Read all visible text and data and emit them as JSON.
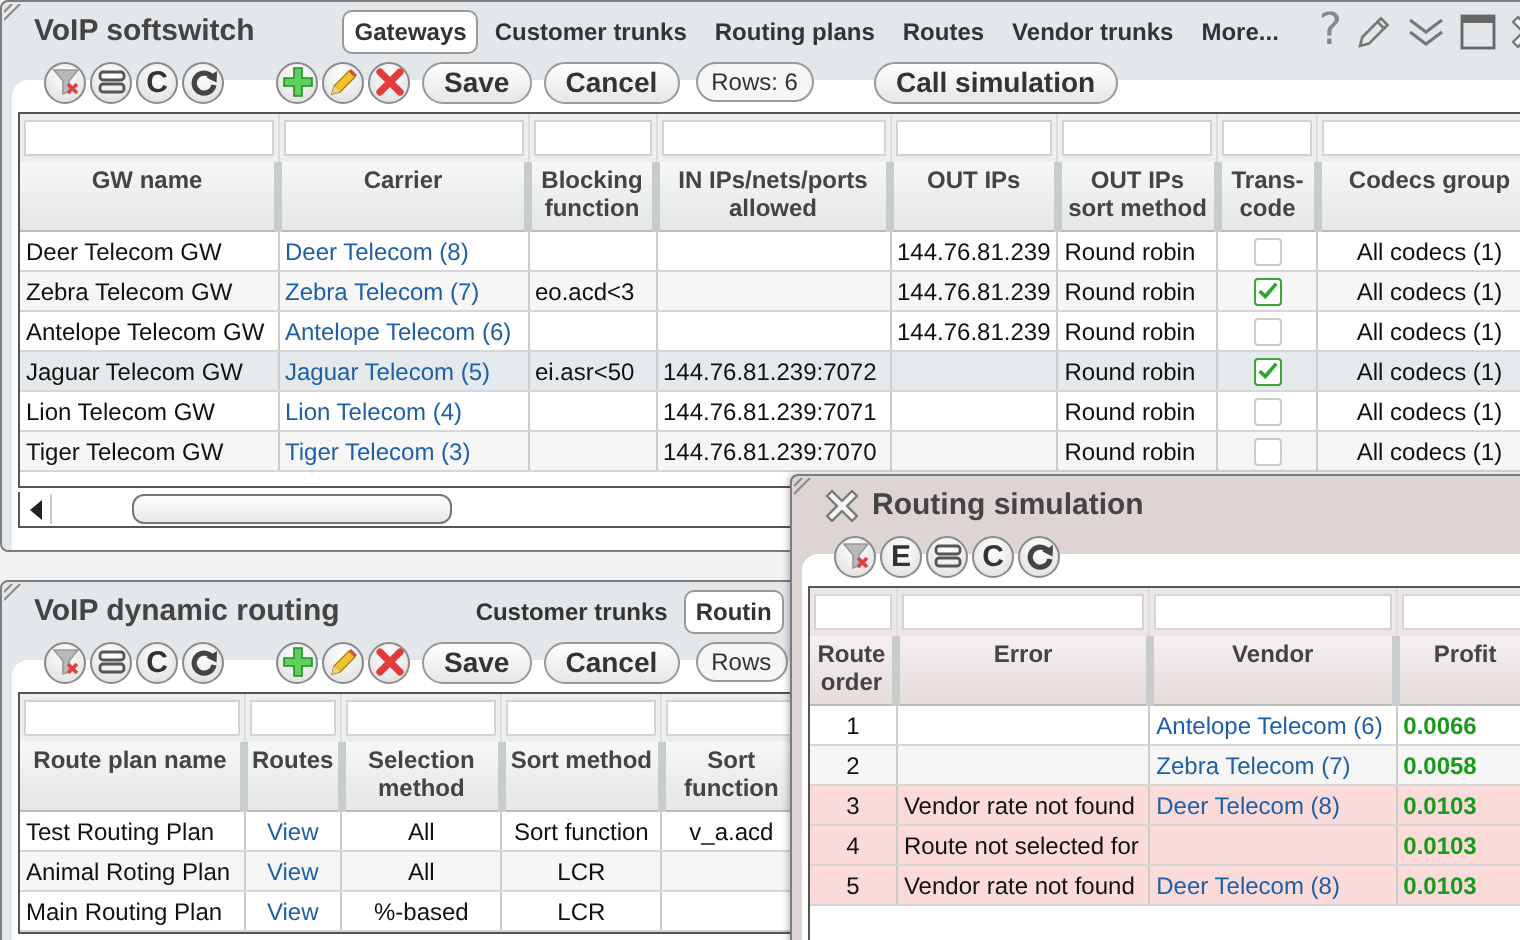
{
  "softswitch_window": {
    "title": "VoIP softswitch",
    "tabs": [
      {
        "label": "Gateways",
        "selected": true
      },
      {
        "label": "Customer trunks",
        "selected": false
      },
      {
        "label": "Routing plans",
        "selected": false
      },
      {
        "label": "Routes",
        "selected": false
      },
      {
        "label": "Vendor trunks",
        "selected": false
      },
      {
        "label": "More...",
        "selected": false
      }
    ],
    "title_controls": [
      {
        "kind": "help",
        "label": "?"
      },
      {
        "kind": "edit"
      },
      {
        "kind": "collapse"
      },
      {
        "kind": "maximize"
      },
      {
        "kind": "close"
      }
    ],
    "toolbar_groups": [
      [
        {
          "kind": "filter-clear"
        },
        {
          "kind": "columns"
        },
        {
          "kind": "letter",
          "label": "C"
        },
        {
          "kind": "refresh"
        }
      ],
      [
        {
          "kind": "add"
        },
        {
          "kind": "edit"
        },
        {
          "kind": "delete"
        },
        {
          "kind": "text",
          "label": "Save"
        },
        {
          "kind": "text",
          "label": "Cancel"
        },
        {
          "kind": "count",
          "label": "Rows: 6"
        }
      ],
      [
        {
          "kind": "text",
          "label": "Call simulation"
        }
      ]
    ],
    "table": {
      "columns": [
        "GW name",
        "Carrier",
        "Blocking function",
        "IN IPs/nets/ports allowed",
        "OUT IPs",
        "OUT IPs sort method",
        "Trans-code",
        "Codecs group"
      ],
      "rows": [
        {
          "gw_name": "Deer Telecom GW",
          "carrier": "Deer Telecom (8)",
          "out_ips": "144.76.81.239",
          "out_sort_method": "Round robin",
          "transcode": false,
          "codecs_group": "All codecs (1)",
          "selected": false
        },
        {
          "gw_name": "Zebra Telecom GW",
          "carrier": "Zebra Telecom (7)",
          "blocking_function": "eo.acd<3",
          "out_ips": "144.76.81.239",
          "out_sort_method": "Round robin",
          "transcode": true,
          "codecs_group": "All codecs (1)",
          "selected": false
        },
        {
          "gw_name": "Antelope Telecom GW",
          "carrier": "Antelope Telecom (6)",
          "out_ips": "144.76.81.239",
          "out_sort_method": "Round robin",
          "transcode": false,
          "codecs_group": "All codecs (1)",
          "selected": false
        },
        {
          "gw_name": "Jaguar Telecom GW",
          "carrier": "Jaguar Telecom (5)",
          "blocking_function": "ei.asr<50",
          "in_ips": "144.76.81.239:7072",
          "out_sort_method": "Round robin",
          "transcode": true,
          "codecs_group": "All codecs (1)",
          "selected": true
        },
        {
          "gw_name": "Lion Telecom GW",
          "carrier": "Lion Telecom (4)",
          "in_ips": "144.76.81.239:7071",
          "out_sort_method": "Round robin",
          "transcode": false,
          "codecs_group": "All codecs (1)",
          "selected": false
        },
        {
          "gw_name": "Tiger Telecom GW",
          "carrier": "Tiger Telecom (3)",
          "in_ips": "144.76.81.239:7070",
          "out_sort_method": "Round robin",
          "transcode": false,
          "codecs_group": "All codecs (1)",
          "selected": false
        }
      ]
    }
  },
  "routing_window": {
    "title": "VoIP dynamic routing",
    "tabs": [
      {
        "label": "Customer trunks",
        "selected": false
      },
      {
        "label": "Routin",
        "selected": true
      }
    ],
    "toolbar_groups": [
      [
        {
          "kind": "filter-clear"
        },
        {
          "kind": "columns"
        },
        {
          "kind": "letter",
          "label": "C"
        },
        {
          "kind": "refresh"
        }
      ],
      [
        {
          "kind": "add"
        },
        {
          "kind": "edit"
        },
        {
          "kind": "delete"
        },
        {
          "kind": "text",
          "label": "Save"
        },
        {
          "kind": "text",
          "label": "Cancel"
        },
        {
          "kind": "count",
          "label": "Rows"
        }
      ]
    ],
    "table": {
      "columns": [
        "Route plan name",
        "Routes",
        "Selection method",
        "Sort method",
        "Sort function"
      ],
      "rows": [
        {
          "name": "Test Routing Plan",
          "routes": "View",
          "selection_method": "All",
          "sort_method": "Sort function",
          "sort_function": "v_a.acd"
        },
        {
          "name": "Animal Roting Plan",
          "routes": "View",
          "selection_method": "All",
          "sort_method": "LCR"
        },
        {
          "name": "Main Routing Plan",
          "routes": "View",
          "selection_method": "%-based",
          "sort_method": "LCR"
        }
      ]
    }
  },
  "simulation_window": {
    "title": "Routing simulation",
    "title_controls": [
      {
        "kind": "close"
      }
    ],
    "toolbar_groups": [
      [
        {
          "kind": "filter-clear"
        },
        {
          "kind": "letter",
          "label": "E"
        },
        {
          "kind": "columns"
        },
        {
          "kind": "letter",
          "label": "C"
        },
        {
          "kind": "refresh"
        }
      ]
    ],
    "table": {
      "columns": [
        "Route order",
        "Error",
        "Vendor",
        "Profit"
      ],
      "rows": [
        {
          "route_order": "1",
          "vendor": "Antelope Telecom (6)",
          "profit": "0.0066"
        },
        {
          "route_order": "2",
          "vendor": "Zebra Telecom (7)",
          "profit": "0.0058"
        },
        {
          "route_order": "3",
          "error": "Vendor rate not found",
          "vendor": "Deer Telecom (8)",
          "profit": "0.0103"
        },
        {
          "route_order": "4",
          "error": "Route not selected for",
          "profit": "0.0103"
        },
        {
          "route_order": "5",
          "error": "Vendor rate not found",
          "vendor": "Deer Telecom (8)",
          "profit": "0.0103"
        }
      ]
    }
  }
}
